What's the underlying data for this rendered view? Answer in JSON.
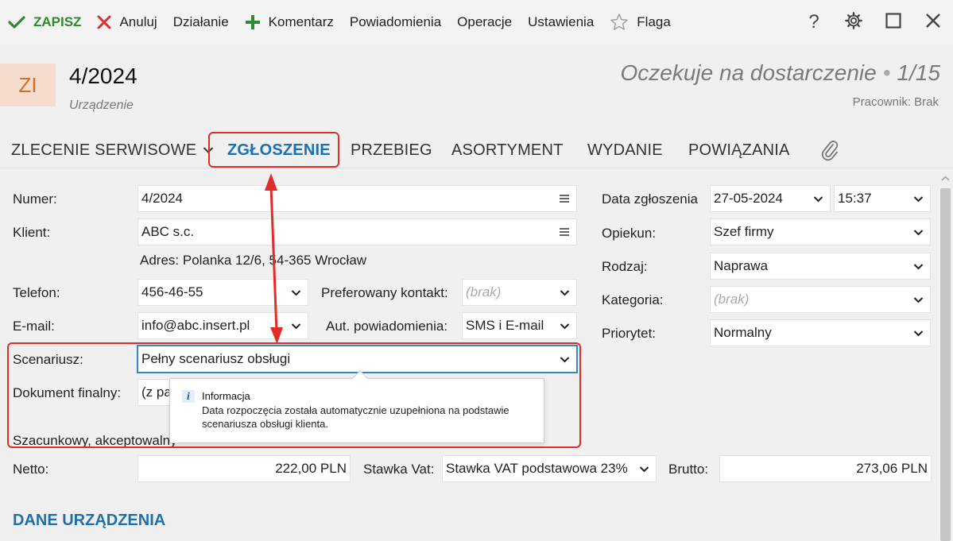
{
  "toolbar": {
    "save": "ZAPISZ",
    "cancel": "Anuluj",
    "action": "Działanie",
    "comment": "Komentarz",
    "notifications": "Powiadomienia",
    "operations": "Operacje",
    "settings": "Ustawienia",
    "flag": "Flaga"
  },
  "header": {
    "badge": "ZI",
    "number": "4/2024",
    "type": "Urządzenie",
    "status": "Oczekuje na dostarczenie",
    "status_dot": "•",
    "progress": "1/15",
    "worker": "Pracownik: Brak"
  },
  "tabs": {
    "service_order": "ZLECENIE SERWISOWE",
    "request": "ZGŁOSZENIE",
    "history": "PRZEBIEG",
    "assortment": "ASORTYMENT",
    "release": "WYDANIE",
    "relations": "POWIĄZANIA"
  },
  "form": {
    "number_label": "Numer:",
    "number_value": "4/2024",
    "client_label": "Klient:",
    "client_value": "ABC s.c.",
    "address": "Adres:  Polanka  12/6, 54-365 Wrocław",
    "phone_label": "Telefon:",
    "phone_value": "456-46-55",
    "pref_contact_label": "Preferowany kontakt:",
    "pref_contact_value": "(brak)",
    "email_label": "E-mail:",
    "email_value": "info@abc.insert.pl",
    "auto_notif_label": "Aut. powiadomienia:",
    "auto_notif_value": "SMS i E-mail",
    "scenario_label": "Scenariusz:",
    "scenario_value": "Pełny scenariusz obsługi",
    "final_doc_label": "Dokument finalny:",
    "final_doc_value": "(z pa",
    "estimate_label": "Szacunkowy, akceptowalny",
    "net_label": "Netto:",
    "net_value": "222,00 PLN",
    "vat_label": "Stawka Vat:",
    "vat_value": "Stawka VAT podstawowa 23%",
    "gross_label": "Brutto:",
    "gross_value": "273,06 PLN",
    "date_label": "Data zgłoszenia",
    "date_value": "27-05-2024",
    "time_value": "15:37",
    "guardian_label": "Opiekun:",
    "guardian_value": "Szef firmy",
    "kind_label": "Rodzaj:",
    "kind_value": "Naprawa",
    "category_label": "Kategoria:",
    "category_value": "(brak)",
    "priority_label": "Priorytet:",
    "priority_value": "Normalny"
  },
  "tooltip": {
    "icon": "i",
    "title": "Informacja",
    "text": "Data rozpoczęcia została automatycznie uzupełniona na podstawie scenariusza obsługi klienta."
  },
  "section": {
    "device_data": "DANE URZĄDZENIA"
  },
  "colors": {
    "accent": "#1d6fb0",
    "highlight": "#e22b2b",
    "save_green": "#2e8a2e",
    "badge_bg": "#f5dccd",
    "badge_fg": "#d86a28"
  },
  "icons": [
    "check-icon",
    "x-icon",
    "plus-icon",
    "star-icon",
    "help-icon",
    "gear-icon",
    "maximize-icon",
    "close-icon",
    "chevron-down-icon",
    "menu-icon",
    "paperclip-icon",
    "info-icon"
  ]
}
